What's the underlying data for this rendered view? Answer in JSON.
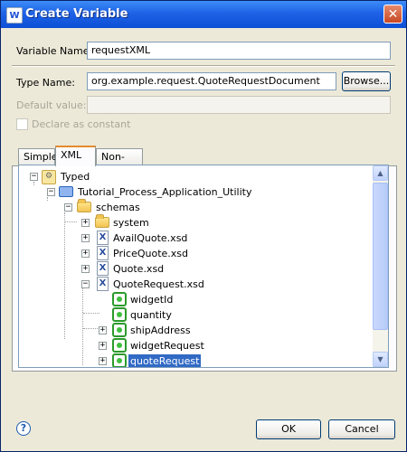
{
  "window": {
    "title": "Create Variable",
    "close_glyph": "✕",
    "app_glyph": "W"
  },
  "form": {
    "variable_name_label": "Variable Name:",
    "variable_name_value": "requestXML",
    "type_name_label": "Type Name:",
    "type_name_value": "org.example.request.QuoteRequestDocument",
    "browse_label": "Browse...",
    "default_value_label": "Default value:",
    "default_value_value": "",
    "constant_label": "Declare as constant",
    "constant_checked": false
  },
  "tabs": [
    {
      "label": "Simple",
      "active": false
    },
    {
      "label": "XML",
      "active": true
    },
    {
      "label": "Non-XML",
      "active": false
    }
  ],
  "tree": {
    "nodes": [
      {
        "label": "Typed",
        "icon": "typed-icon",
        "expander": "−"
      },
      {
        "label": "Tutorial_Process_Application_Utility",
        "icon": "project-folder-icon",
        "expander": "−"
      },
      {
        "label": "schemas",
        "icon": "folder-icon",
        "expander": "−"
      },
      {
        "label": "system",
        "icon": "folder-icon",
        "expander": "+"
      },
      {
        "label": "AvailQuote.xsd",
        "icon": "xsd-file-icon",
        "expander": "+"
      },
      {
        "label": "PriceQuote.xsd",
        "icon": "xsd-file-icon",
        "expander": "+"
      },
      {
        "label": "Quote.xsd",
        "icon": "xsd-file-icon",
        "expander": "+"
      },
      {
        "label": "QuoteRequest.xsd",
        "icon": "xsd-file-icon",
        "expander": "−"
      },
      {
        "label": "widgetId",
        "icon": "element-icon",
        "expander": ""
      },
      {
        "label": "quantity",
        "icon": "element-icon",
        "expander": ""
      },
      {
        "label": "shipAddress",
        "icon": "element-icon",
        "expander": "+"
      },
      {
        "label": "widgetRequest",
        "icon": "element-icon",
        "expander": "+"
      },
      {
        "label": "quoteRequest",
        "icon": "element-icon",
        "expander": "+",
        "selected": true
      }
    ]
  },
  "footer": {
    "help_glyph": "?",
    "ok_label": "OK",
    "cancel_label": "Cancel"
  },
  "colors": {
    "titlebar": "#0b4fd6",
    "selection": "#316ac5",
    "dialog_bg": "#ece9d8"
  }
}
